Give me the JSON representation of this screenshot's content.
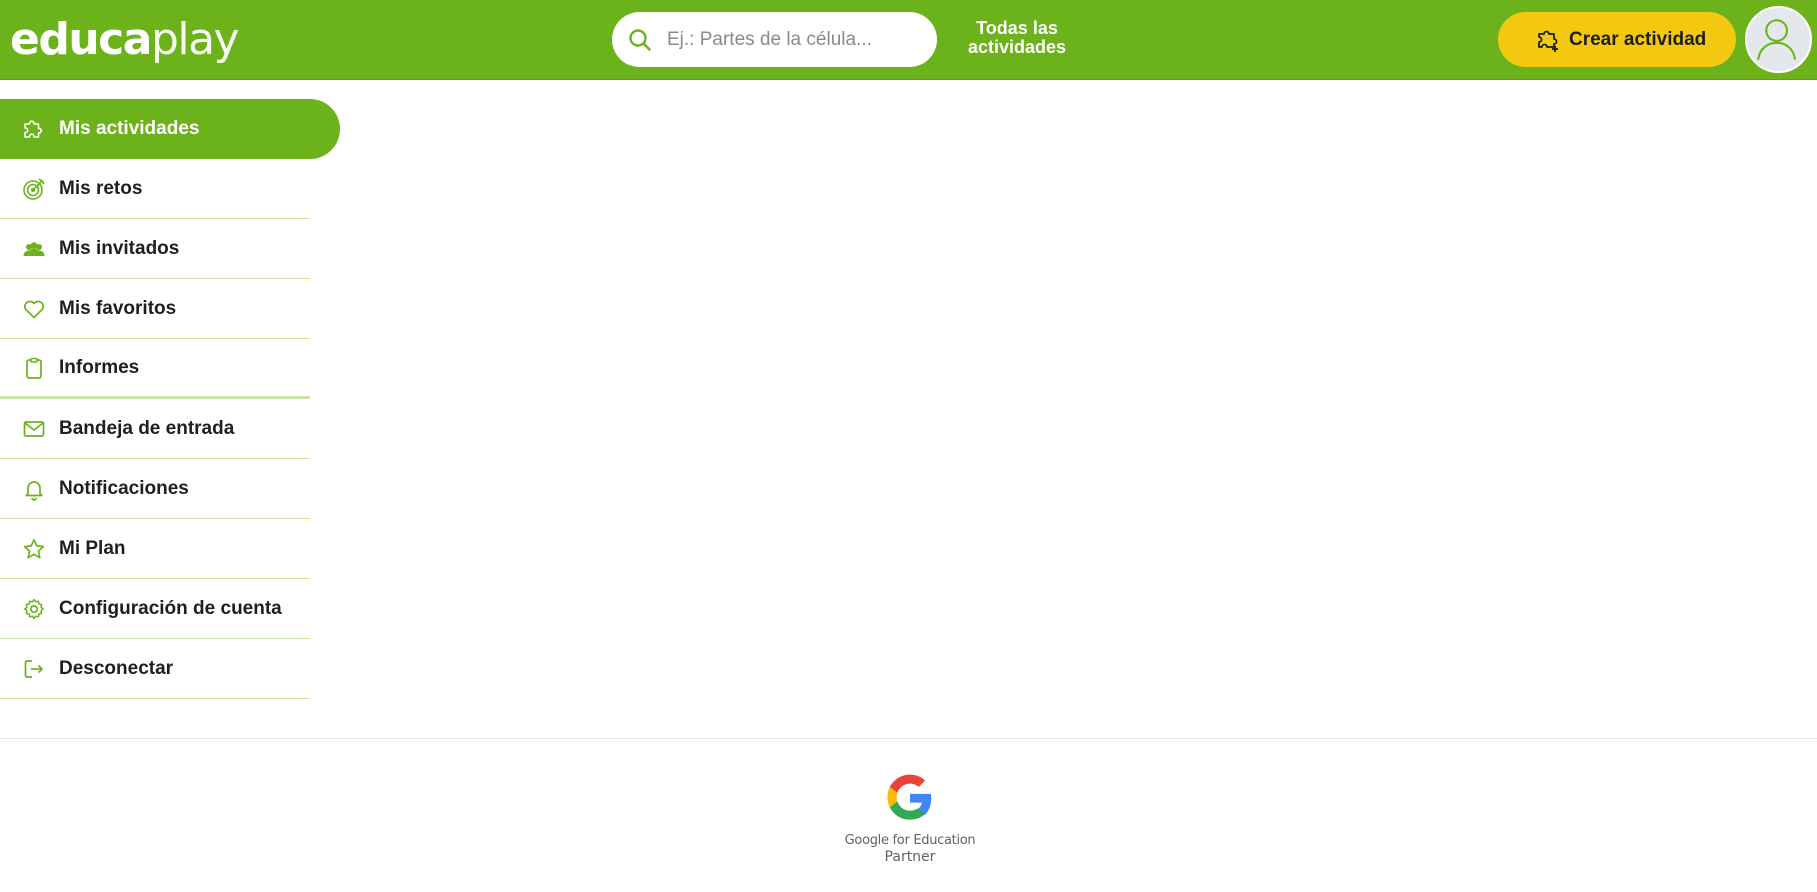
{
  "header": {
    "logo": {
      "part1": "educa",
      "part2": "play"
    },
    "search": {
      "placeholder": "Ej.: Partes de la célula...",
      "value": ""
    },
    "all_activities_label": "Todas las actividades",
    "create_button_label": "Crear actividad",
    "avatar_icon": "user-avatar-icon"
  },
  "sidebar": {
    "items": [
      {
        "label": "Mis actividades",
        "icon": "puzzle-icon",
        "active": true
      },
      {
        "label": "Mis retos",
        "icon": "target-icon"
      },
      {
        "label": "Mis invitados",
        "icon": "users-icon"
      },
      {
        "label": "Mis favoritos",
        "icon": "heart-icon"
      },
      {
        "label": "Informes",
        "icon": "clipboard-icon"
      },
      {
        "label": "Bandeja de entrada",
        "icon": "mail-icon"
      },
      {
        "label": "Notificaciones",
        "icon": "bell-icon"
      },
      {
        "label": "Mi Plan",
        "icon": "star-icon"
      },
      {
        "label": "Configuración de cuenta",
        "icon": "gear-icon"
      },
      {
        "label": "Desconectar",
        "icon": "logout-icon"
      }
    ]
  },
  "footer": {
    "badge_line1": "Google for Education",
    "badge_line2": "Partner"
  },
  "colors": {
    "brand_green": "#6cb31b",
    "create_yellow": "#f2c811",
    "divider_green": "#c9e5a0"
  }
}
